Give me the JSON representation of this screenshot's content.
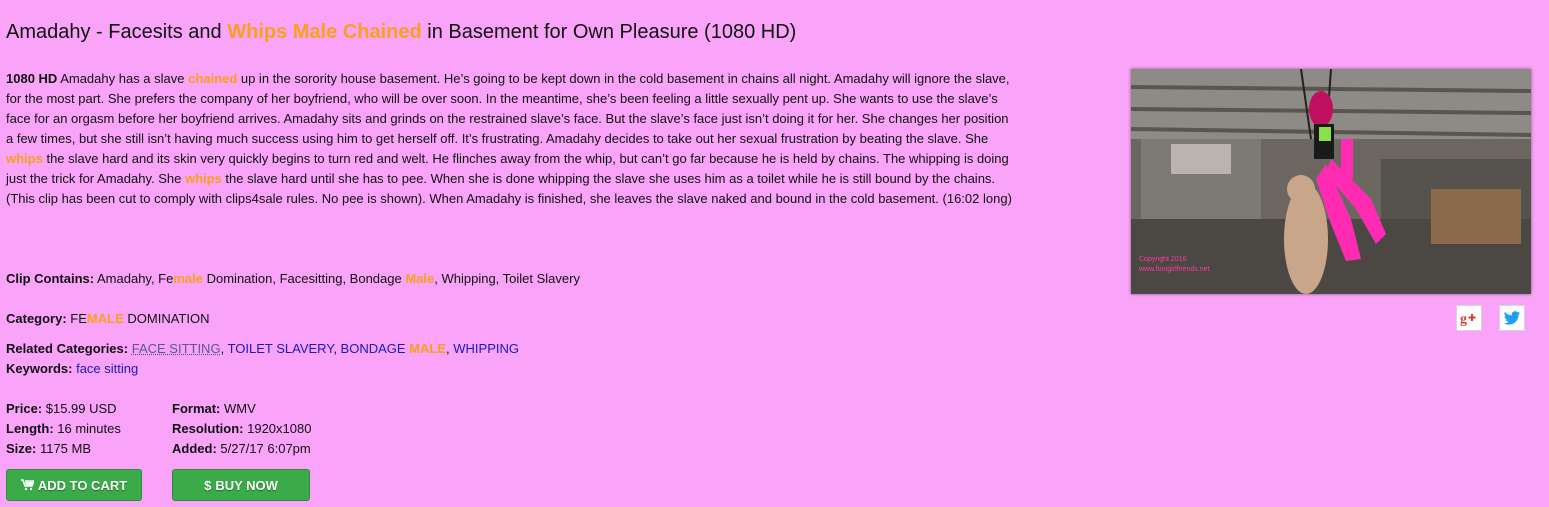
{
  "title": {
    "p1": "Amadahy - Facesits and ",
    "hl": "Whips Male Chained",
    "p2": " in Basement for Own Pleasure (1080 HD)"
  },
  "description": {
    "lead": "1080 HD",
    "t1": " Amadahy has a slave ",
    "h1": "chained",
    "t2": " up in the sorority house basement. He’s going to be kept down in the cold basement in chains all night. Amadahy will ignore the slave, for the most part. She prefers the company of her boyfriend, who will be over soon. In the meantime, she’s been feeling a little sexually pent up. She wants to use the slave’s face for an orgasm before her boyfriend arrives. Amadahy sits and grinds on the restrained slave’s face. But the slave’s face just isn’t doing it for her. She changes her position a few times, but she still isn’t having much success using him to get herself off. It’s frustrating. Amadahy decides to take out her sexual frustration by beating the slave.  She ",
    "h2": "whips",
    "t3": " the slave hard and its skin very quickly begins to turn red and welt. He flinches away from the whip, but can’t go far because he is held by chains. The whipping is doing just the trick for Amadahy. She ",
    "h3": "whips",
    "t4": " the slave hard until she has to pee. When she is done whipping the slave she uses him as a toilet while he is still bound by the chains. (This clip has been cut to comply with clips4sale rules. No pee is shown). When Amadahy is finished, she leaves the slave naked and bound in the cold basement. (16:02 long)"
  },
  "clip_contains": {
    "label": "Clip Contains:",
    "t1": " Amadahy, Fe",
    "h1": "male",
    "t2": " Domination, Facesitting, Bondage ",
    "h2": "Male",
    "t3": ", Whipping, Toilet Slavery"
  },
  "category": {
    "label": "Category:",
    "t1": " FE",
    "h1": "MALE",
    "t2": " DOMINATION"
  },
  "related": {
    "label": "Related Categories:",
    "c1": "FACE SITTING",
    "sep": ", ",
    "c2": "TOILET SLAVERY",
    "c3a": "BONDAGE ",
    "c3h": "MALE",
    "c4": "WHIPPING"
  },
  "keywords": {
    "label": "Keywords:",
    "k1": "face sitting"
  },
  "details": {
    "price_label": "Price:",
    "price": " $15.99 USD",
    "length_label": "Length:",
    "length": " 16 minutes",
    "size_label": "Size:",
    "size": " 1175 MB",
    "format_label": "Format:",
    "format": " WMV",
    "resolution_label": "Resolution:",
    "resolution": " 1920x1080",
    "added_label": "Added:",
    "added": " 5/27/17 6:07pm"
  },
  "buttons": {
    "add_to_cart": "ADD TO CART",
    "buy_now": "BUY NOW",
    "dollar": "$"
  },
  "thumbnail": {
    "copyright": "Copyright 2016",
    "site": "www.fontgirlfriends.net"
  },
  "colors": {
    "background": "#f9a3f9",
    "highlight": "#f7a21b",
    "link": "#1a1ab8",
    "button": "#3aab48"
  },
  "icons": [
    "cart-icon",
    "google-plus-icon",
    "twitter-icon"
  ]
}
